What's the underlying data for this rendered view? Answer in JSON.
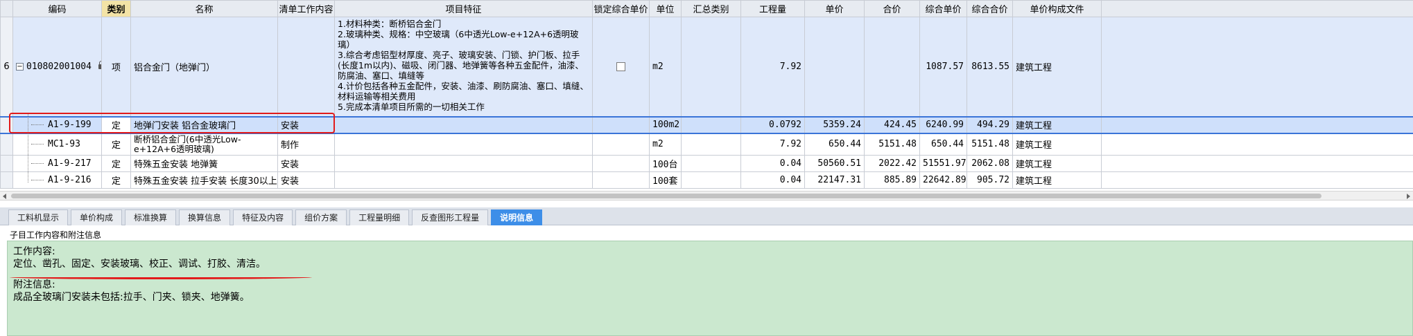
{
  "columns": [
    "编码",
    "类别",
    "名称",
    "清单工作内容",
    "项目特征",
    "锁定综合单价",
    "单位",
    "汇总类别",
    "工程量",
    "单价",
    "合价",
    "综合单价",
    "综合合价",
    "单价构成文件"
  ],
  "main_row": {
    "row_number": "6",
    "tree_toggle": "−",
    "code": "010802001004",
    "category": "项",
    "name": "铝合金门（地弹门）",
    "work_content": "",
    "features": [
      "1.材料种类：断桥铝合金门",
      "2.玻璃种类、规格：中空玻璃（6中透光Low-e+12A+6透明玻璃）",
      "3.综合考虑铝型材厚度、亮子、玻璃安装、门锁、护门板、拉手(长度1m以内)、磁吸、闭门器、地弹簧等各种五金配件，油漆、防腐油、塞口、填缝等",
      "4.计价包括各种五金配件，安装、油漆、刷防腐油、塞口、填缝、材料运输等相关费用",
      "5.完成本清单项目所需的一切相关工作"
    ],
    "unit": "m2",
    "summary_type": "",
    "quantity": "7.92",
    "unit_price": "",
    "total_price": "",
    "composite_unit_price": "1087.57",
    "composite_total": "8613.55",
    "price_file": "建筑工程"
  },
  "sub_rows": [
    {
      "code": "A1-9-199",
      "category": "定",
      "name": "地弹门安装 铝合金玻璃门",
      "work_content": "安装",
      "features": "",
      "unit": "100m2",
      "summary_type": "",
      "quantity": "0.0792",
      "unit_price": "5359.24",
      "total_price": "424.45",
      "composite_unit_price": "6240.99",
      "composite_total": "494.29",
      "price_file": "建筑工程"
    },
    {
      "code": "MC1-93",
      "category": "定",
      "name": "断桥铝合金门(6中透光Low-e+12A+6透明玻璃)",
      "work_content": "制作",
      "features": "",
      "unit": "m2",
      "summary_type": "",
      "quantity": "7.92",
      "unit_price": "650.44",
      "total_price": "5151.48",
      "composite_unit_price": "650.44",
      "composite_total": "5151.48",
      "price_file": "建筑工程"
    },
    {
      "code": "A1-9-217",
      "category": "定",
      "name": "特殊五金安装 地弹簧",
      "work_content": "安装",
      "features": "",
      "unit": "100台",
      "summary_type": "",
      "quantity": "0.04",
      "unit_price": "50560.51",
      "total_price": "2022.42",
      "composite_unit_price": "51551.97",
      "composite_total": "2062.08",
      "price_file": "建筑工程"
    },
    {
      "code": "A1-9-216",
      "category": "定",
      "name": "特殊五金安装 拉手安装 长度30以上",
      "work_content": "安装",
      "features": "",
      "unit": "100套",
      "summary_type": "",
      "quantity": "0.04",
      "unit_price": "22147.31",
      "total_price": "885.89",
      "composite_unit_price": "22642.89",
      "composite_total": "905.72",
      "price_file": "建筑工程"
    }
  ],
  "tabs": [
    "工料机显示",
    "单价构成",
    "标准换算",
    "换算信息",
    "特征及内容",
    "组价方案",
    "工程量明细",
    "反查图形工程量",
    "说明信息"
  ],
  "active_tab_index": 8,
  "info": {
    "title": "子目工作内容和附注信息",
    "work_label": "工作内容:",
    "work_text": "定位、凿孔、固定、安装玻璃、校正、调试、打胶、清洁。",
    "note_label": "附注信息:",
    "note_text": "成品全玻璃门安装未包括:拉手、门夹、锁夹、地弹簧。"
  },
  "colors": {
    "selection": "#cfe0fb",
    "main_row": "#dfe9fa",
    "active_tab": "#3d8ee8",
    "info_bg": "#cbe8cf",
    "annotation": "#e21a1a"
  }
}
